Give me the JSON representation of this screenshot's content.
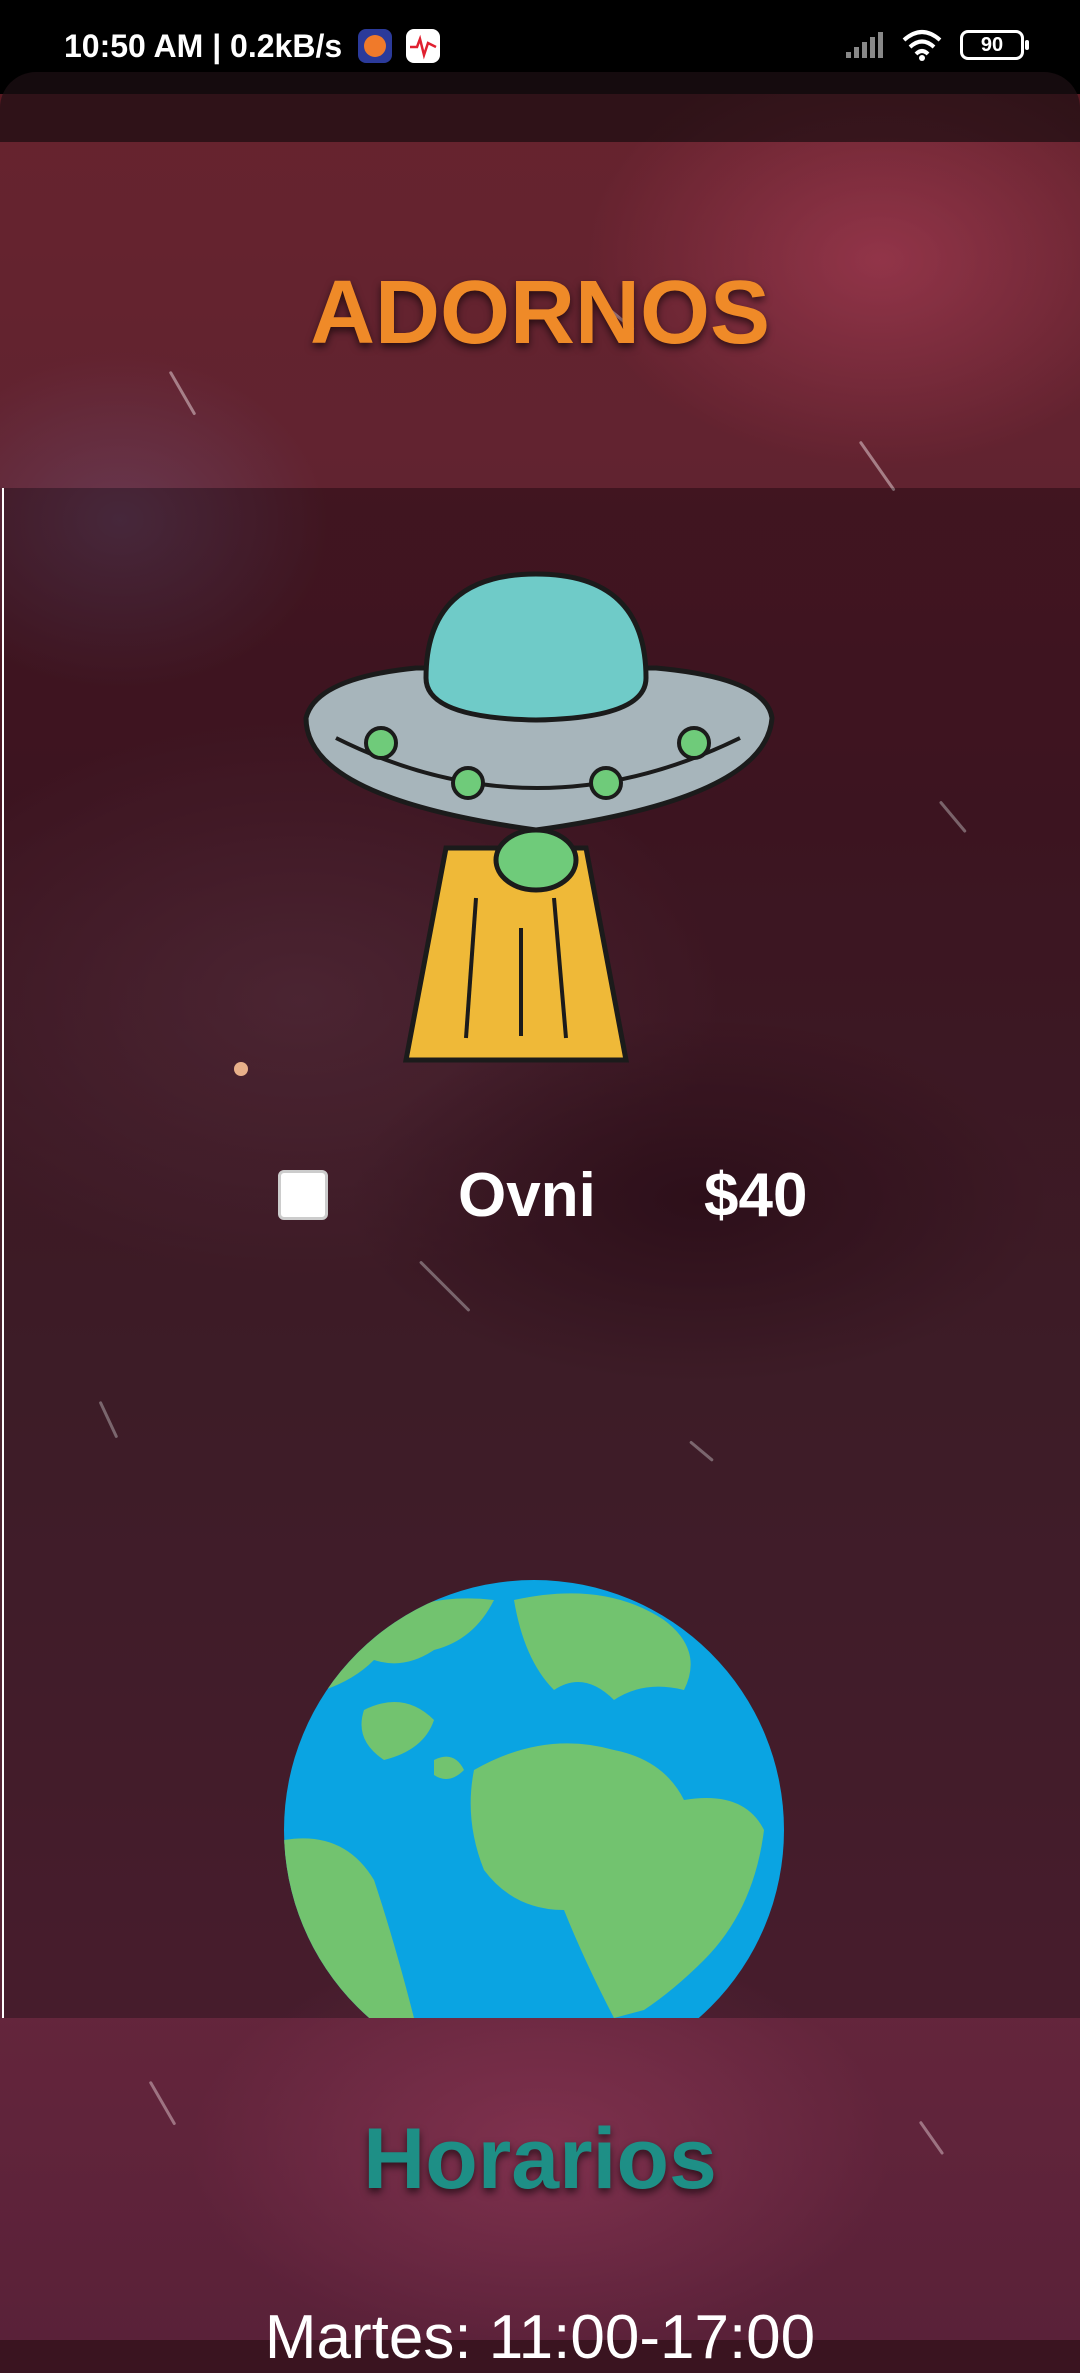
{
  "status_bar": {
    "time": "10:50 AM | 0.2kB/s",
    "battery": "90"
  },
  "header": {
    "title": "ADORNOS",
    "title_color": "#ef8a28"
  },
  "products": [
    {
      "image": "ufo-illustration",
      "name": "Ovni",
      "price": "$40",
      "checked": false
    },
    {
      "image": "earth-globe-illustration"
    }
  ],
  "footer": {
    "title": "Horarios",
    "title_color": "#1e8f86",
    "hours": "Martes: 11:00-17:00"
  }
}
